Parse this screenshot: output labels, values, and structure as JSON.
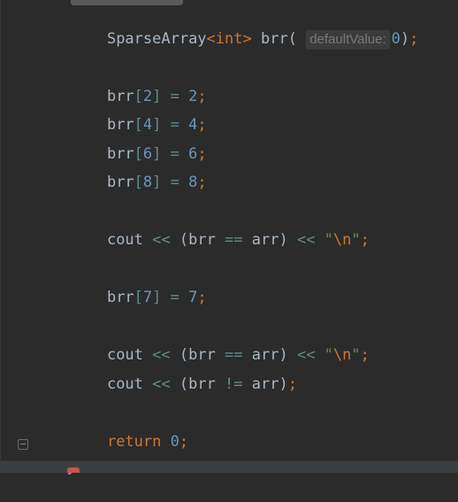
{
  "editor": {
    "line1": {
      "type_name": "SparseArray",
      "lt": "<",
      "type_arg": "int",
      "gt": ">",
      "var_open": " brr(",
      "hint": "defaultValue:",
      "value": "0",
      "close": ")",
      "semi": ";"
    },
    "assignments": [
      {
        "var": "brr",
        "lb": "[",
        "index": "2",
        "rb": "]",
        "eq": " = ",
        "value": "2",
        "semi": ";"
      },
      {
        "var": "brr",
        "lb": "[",
        "index": "4",
        "rb": "]",
        "eq": " = ",
        "value": "4",
        "semi": ";"
      },
      {
        "var": "brr",
        "lb": "[",
        "index": "6",
        "rb": "]",
        "eq": " = ",
        "value": "6",
        "semi": ";"
      },
      {
        "var": "brr",
        "lb": "[",
        "index": "8",
        "rb": "]",
        "eq": " = ",
        "value": "8",
        "semi": ";"
      }
    ],
    "cout_eq_1": {
      "cout": "cout",
      "shl1": " << ",
      "lhs": "(brr",
      "op": " == ",
      "rhs": "arr)",
      "shl2": " << ",
      "q1": "\"",
      "esc": "\\n",
      "q2": "\"",
      "semi": ";"
    },
    "assign7": {
      "var": "brr",
      "lb": "[",
      "index": "7",
      "rb": "]",
      "eq": " = ",
      "value": "7",
      "semi": ";"
    },
    "cout_eq_2": {
      "cout": "cout",
      "shl1": " << ",
      "lhs": "(brr",
      "op": " == ",
      "rhs": "arr)",
      "shl2": " << ",
      "q1": "\"",
      "esc": "\\n",
      "q2": "\"",
      "semi": ";"
    },
    "cout_ne": {
      "cout": "cout",
      "shl1": " << ",
      "lhs": "(brr",
      "op": " != ",
      "rhs": "arr)",
      "semi": ";"
    },
    "return_line": {
      "kw": "return",
      "space": " ",
      "value": "0",
      "semi": ";"
    },
    "closing_brace": "}"
  },
  "colors": {
    "background": "#2b2b2b",
    "keyword": "#cc7832",
    "number": "#6897bb",
    "string": "#6a8759",
    "identifier": "#a9b7c6",
    "operator": "#5f8c8a",
    "hint": "#787878"
  }
}
